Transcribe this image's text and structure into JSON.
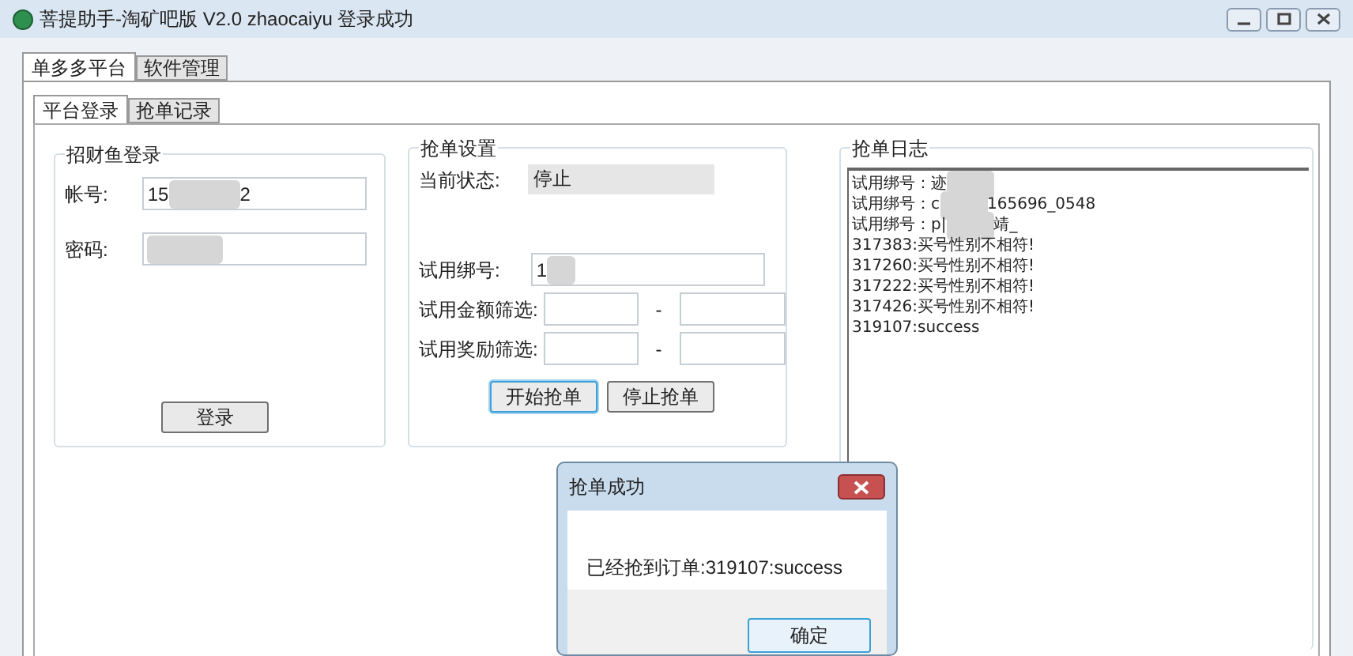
{
  "window": {
    "title": "菩提助手-淘矿吧版 V2.0 zhaocaiyu 登录成功"
  },
  "tabs": [
    {
      "label": "单多多平台",
      "selected": true
    },
    {
      "label": "软件管理",
      "selected": false
    }
  ],
  "sub_tabs": [
    {
      "label": "平台登录",
      "selected": true
    },
    {
      "label": "抢单记录",
      "selected": false
    }
  ],
  "login": {
    "title": "招财鱼登录",
    "account": {
      "label": "帐号:",
      "value_start": "15",
      "value_end": "2"
    },
    "password": {
      "label": "密码:"
    },
    "button": "登录"
  },
  "settings": {
    "title": "抢单设置",
    "status": {
      "label": "当前状态:",
      "value": "停止"
    },
    "trial_id": {
      "label": "试用绑号:",
      "value": "1"
    },
    "amount_filter": {
      "label": "试用金额筛选:",
      "separator": "-"
    },
    "reward_filter": {
      "label": "试用奖励筛选:",
      "separator": "-"
    },
    "buttons": [
      {
        "label": "开始抢单",
        "focused": true
      },
      {
        "label": "停止抢单",
        "focused": false
      }
    ]
  },
  "log": {
    "title": "抢单日志",
    "lines": [
      {
        "text": "试用绑号：迹",
        "blurred": true
      },
      {
        "text": "试用绑号：c",
        "blurred": true,
        "tail": "165696_0548"
      },
      {
        "text": "试用绑号：p|",
        "blurred": true,
        "tail": "靖_"
      },
      {
        "text": "317383:买号性别不相符!",
        "blurred": false
      },
      {
        "text": "317260:买号性别不相符!",
        "blurred": false
      },
      {
        "text": "317222:买号性别不相符!",
        "blurred": false
      },
      {
        "text": "317426:买号性别不相符!",
        "blurred": false
      },
      {
        "text": "319107:success",
        "blurred": false
      }
    ]
  },
  "dialog": {
    "title": "抢单成功",
    "message": "已经抢到订单:319107:success",
    "button": "确定"
  }
}
